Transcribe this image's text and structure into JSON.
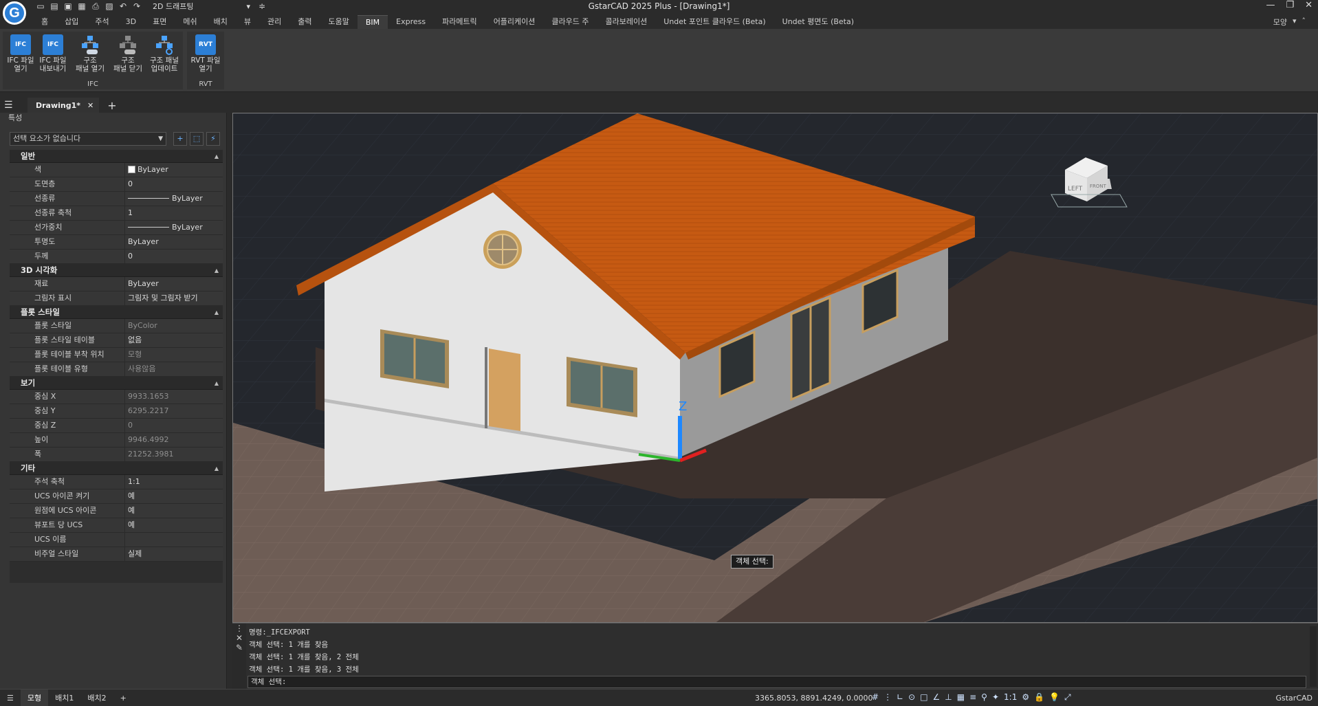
{
  "app": {
    "title": "GstarCAD 2025 Plus - [Drawing1*]",
    "logo": "G",
    "workspace": "2D 드래프팅",
    "mode_label": "모양",
    "accent": "#2c7fd6"
  },
  "menu_tabs": [
    "홈",
    "삽입",
    "주석",
    "3D",
    "표면",
    "메쉬",
    "배치",
    "뷰",
    "관리",
    "출력",
    "도움말",
    "BIM",
    "Express",
    "파라메트릭",
    "어플리케이션",
    "클라우드 주",
    "콜라보레이션",
    "Undet 포인트 클라우드 (Beta)",
    "Undet 평면도 (Beta)"
  ],
  "active_tab": "BIM",
  "ribbon": {
    "groups": [
      {
        "label": "IFC",
        "buttons": [
          {
            "icon": "ifc-open-icon",
            "icon_text": "IFC",
            "line1": "IFC 파일",
            "line2": "열기"
          },
          {
            "icon": "ifc-export-icon",
            "icon_text": "IFC",
            "line1": "IFC 파일",
            "line2": "내보내기"
          },
          {
            "icon": "structure-panel-open-icon",
            "icon_text": "",
            "line1": "구조",
            "line2": "패널 열기"
          },
          {
            "icon": "structure-panel-close-icon",
            "icon_text": "",
            "line1": "구조",
            "line2": "패널 닫기"
          },
          {
            "icon": "structure-panel-update-icon",
            "icon_text": "",
            "line1": "구조 패널",
            "line2": "업데이트"
          }
        ]
      },
      {
        "label": "RVT",
        "buttons": [
          {
            "icon": "rvt-open-icon",
            "icon_text": "RVT",
            "line1": "RVT 파일",
            "line2": "열기"
          }
        ]
      }
    ]
  },
  "document": {
    "tab": "Drawing1*"
  },
  "properties": {
    "title": "특성",
    "selection": "선택 요소가 없습니다",
    "sections": [
      {
        "name": "일반",
        "rows": [
          {
            "key": "색",
            "value": "ByLayer",
            "swatch": true
          },
          {
            "key": "도면층",
            "value": "0"
          },
          {
            "key": "선종류",
            "value": "ByLayer",
            "line": true
          },
          {
            "key": "선종류 축척",
            "value": "1"
          },
          {
            "key": "선가중치",
            "value": "ByLayer",
            "line": true
          },
          {
            "key": "투명도",
            "value": "ByLayer"
          },
          {
            "key": "두께",
            "value": "0"
          }
        ]
      },
      {
        "name": "3D 시각화",
        "rows": [
          {
            "key": "재료",
            "value": "ByLayer"
          },
          {
            "key": "그림자 표시",
            "value": "그림자 및 그림자 받기"
          }
        ]
      },
      {
        "name": "플롯 스타일",
        "rows": [
          {
            "key": "플롯 스타일",
            "value": "ByColor",
            "dim": true
          },
          {
            "key": "플롯 스타일 테이블",
            "value": "없음"
          },
          {
            "key": "플롯 테이블 부착 위치",
            "value": "모형",
            "dim": true
          },
          {
            "key": "플롯 테이블 유형",
            "value": "사용않음",
            "dim": true
          }
        ]
      },
      {
        "name": "보기",
        "rows": [
          {
            "key": "중심 X",
            "value": "9933.1653",
            "dim": true
          },
          {
            "key": "중심 Y",
            "value": "6295.2217",
            "dim": true
          },
          {
            "key": "중심 Z",
            "value": "0",
            "dim": true
          },
          {
            "key": "높이",
            "value": "9946.4992",
            "dim": true
          },
          {
            "key": "폭",
            "value": "21252.3981",
            "dim": true
          }
        ]
      },
      {
        "name": "기타",
        "rows": [
          {
            "key": "주석 축척",
            "value": "1:1"
          },
          {
            "key": "UCS 아이콘 켜기",
            "value": "예"
          },
          {
            "key": "원점에 UCS 아이콘",
            "value": "예"
          },
          {
            "key": "뷰포트 당 UCS",
            "value": "예"
          },
          {
            "key": "UCS 이름",
            "value": ""
          },
          {
            "key": "비주얼 스타일",
            "value": "실제"
          }
        ]
      }
    ]
  },
  "viewport": {
    "tooltip": "객체 선택:",
    "viewcube_left": "LEFT",
    "viewcube_front": "FRONT",
    "axis_z": "Z",
    "colors": {
      "roof": "#c2540f",
      "wall": "#e4e4e4",
      "ground": "#6b5b52",
      "background": "#24272d"
    }
  },
  "command": {
    "lines": [
      "명령:_IFCEXPORT",
      "객체 선택: 1 개를 찾음",
      "객체 선택: 1 개를 찾음, 2 전체",
      "객체 선택: 1 개를 찾음, 3 전체"
    ],
    "prompt": "객체 선택:"
  },
  "status": {
    "tabs": [
      "모형",
      "배치1",
      "배치2"
    ],
    "active": "모형",
    "coords": "3365.8053, 8891.4249, 0.0000",
    "scale": "1:1",
    "brand": "GstarCAD"
  }
}
